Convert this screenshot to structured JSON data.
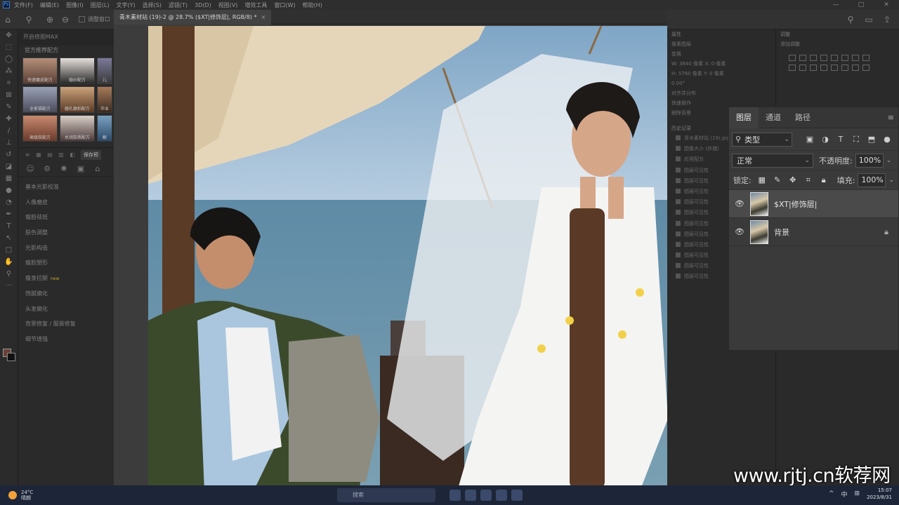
{
  "menu": {
    "items": [
      "文件(F)",
      "编辑(E)",
      "图像(I)",
      "图层(L)",
      "文字(Y)",
      "选择(S)",
      "滤镜(T)",
      "3D(D)",
      "视图(V)",
      "增效工具",
      "窗口(W)",
      "帮助(H)"
    ],
    "window_controls": [
      "—",
      "□",
      "✕"
    ]
  },
  "options": {
    "checkbox_label": "调整窗口"
  },
  "plugin": {
    "title": "开启修图MAX",
    "section": "官方推荐配方",
    "thumbs": [
      "快速磨皮配方",
      "婚纱配方",
      "儿",
      "全家福配方",
      "婚礼跟拍配方",
      "毕业",
      "高级肤配方",
      "水润肤质配方",
      "解"
    ],
    "save_label": "保存预",
    "functions": [
      "基本光影校准",
      "人像磨皮",
      "瘦脸祛斑",
      "肤色调整",
      "光影构造",
      "瘦脸塑形",
      "瘦身拉腿",
      "饱腻偏化",
      "头发偏化",
      "背景修复 / 服装修复",
      "细节增强"
    ],
    "new_badge": "new"
  },
  "document": {
    "tab_title": "青木素材站 (19)-2 @ 28.7% ($XT|修饰层|, RGB/8) *",
    "close": "×"
  },
  "right": {
    "col1_title": "属性",
    "col1_items": [
      "像素图层",
      "变换",
      "W: 3840 像素   X: 0 像素",
      "H: 5760 像素   Y: 0 像素",
      "0.00°",
      "对齐并分布",
      "快速操作",
      "删除背景"
    ],
    "col2_title": "调整",
    "col2_sub": "添加调整",
    "history_title": "历史记录",
    "history_items": [
      "青木素材站 (19).jpg",
      "图像大小 (存储)",
      "应用配方",
      "图层可见性",
      "图层可见性",
      "图层可见性",
      "图层可见性",
      "图层可见性",
      "图层可见性",
      "图层可见性",
      "图层可见性",
      "图层可见性",
      "图层可见性",
      "图层可见性"
    ]
  },
  "layers": {
    "tabs": [
      "图层",
      "通道",
      "路径"
    ],
    "filter_label": "类型",
    "filter_icons": [
      "image-filter",
      "adjust-filter",
      "text-filter",
      "shape-filter",
      "smart-filter"
    ],
    "blend_mode": "正常",
    "opacity_label": "不透明度:",
    "opacity_value": "100%",
    "lock_label": "锁定:",
    "fill_label": "填充:",
    "fill_value": "100%",
    "items": [
      {
        "name": "$XT|修饰层|",
        "selected": true,
        "visible": true,
        "locked": false
      },
      {
        "name": "背景",
        "selected": false,
        "visible": true,
        "locked": true
      }
    ]
  },
  "watermark": "www.rjtj.cn软荐网",
  "taskbar": {
    "temperature": "24°C",
    "weather": "晴朗",
    "search_placeholder": "搜索",
    "tray": [
      "^",
      "中",
      "⊞"
    ],
    "time": "15:07",
    "date": "2023/8/31"
  }
}
